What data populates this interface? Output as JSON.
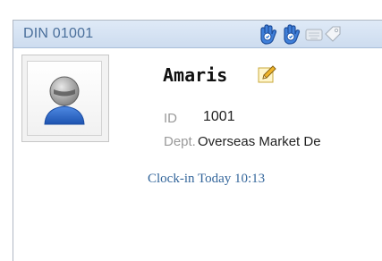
{
  "header": {
    "din": "DIN 01001",
    "icons": [
      "hand-blue-icon",
      "hand-blue-icon",
      "keyboard-icon",
      "tag-icon"
    ]
  },
  "employee": {
    "photo_icon": "user-avatar-icon",
    "name": "Amaris",
    "edit_icon": "pencil-icon",
    "id_label": "ID",
    "id_value": "1001",
    "dept_label": "Dept.",
    "dept_value": "Overseas Market De",
    "clock_in": "Clock-in Today 10:13"
  },
  "colors": {
    "header_bg": "#d6e4f4",
    "din_text": "#4a6f9b",
    "clock_text": "#34669b"
  }
}
